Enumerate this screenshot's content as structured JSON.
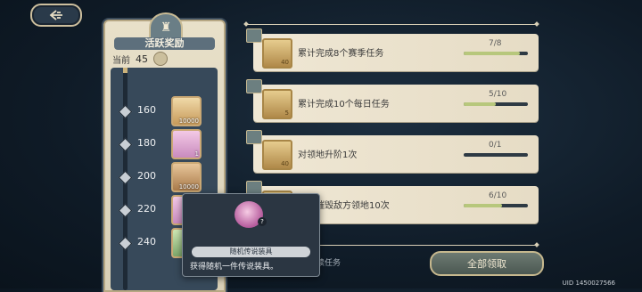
{
  "left": {
    "title": "活跃奖励",
    "current_label": "当前",
    "current_value": "45",
    "milestones": [
      {
        "value": "160",
        "reward_qty": "10000",
        "reward_style": "gold"
      },
      {
        "value": "180",
        "reward_qty": "1",
        "reward_style": "pink"
      },
      {
        "value": "200",
        "reward_qty": "10000",
        "reward_style": "sand"
      },
      {
        "value": "220",
        "reward_qty": "1",
        "reward_style": "pink"
      },
      {
        "value": "240",
        "reward_qty": "",
        "reward_style": "green"
      }
    ]
  },
  "tasks": [
    {
      "label": "累计完成8个赛季任务",
      "icon_num": "40",
      "progress_text": "7/8",
      "progress": 0.875
    },
    {
      "label": "累计完成10个每日任务",
      "icon_num": "5",
      "progress_text": "5/10",
      "progress": 0.5
    },
    {
      "label": "对领地升阶1次",
      "icon_num": "40",
      "progress_text": "0/1",
      "progress": 0
    },
    {
      "label": "累计摧毁敌方领地10次",
      "icon_num": "",
      "progress_text": "6/10",
      "progress": 0.6
    }
  ],
  "footnote": "后续任务",
  "claim_all": "全部领取",
  "uid": "UID 1450027566",
  "tooltip": {
    "item_name": "随机传说装具",
    "description": "获得随机一件传说装具。",
    "badge": "?"
  }
}
